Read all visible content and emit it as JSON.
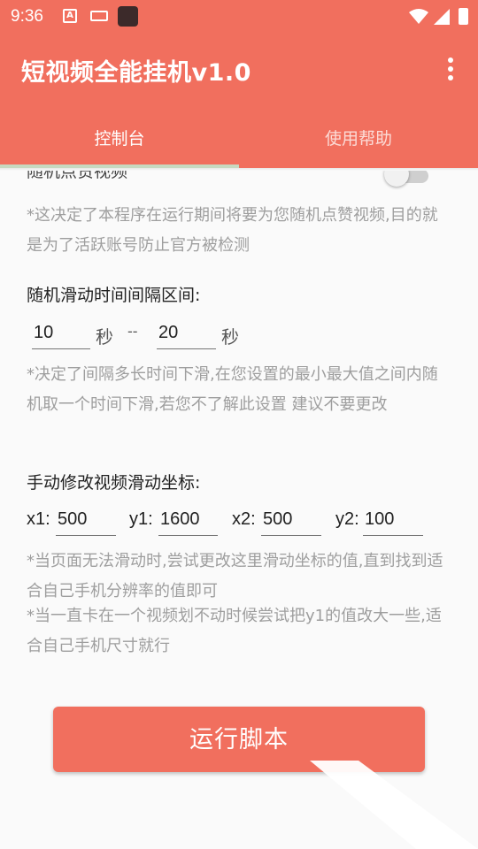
{
  "status_bar": {
    "time": "9:36",
    "a_icon": "A"
  },
  "app_bar": {
    "title": "短视频全能挂机v1.0"
  },
  "tabs": [
    {
      "label": "控制台"
    },
    {
      "label": "使用帮助"
    }
  ],
  "like_section": {
    "label": "随机点赞视频",
    "enabled": false,
    "note": "*这决定了本程序在运行期间将要为您随机点赞视频,目的就是为了活跃账号防止官方被检测"
  },
  "interval_section": {
    "label": "随机滑动时间间隔区间:",
    "min_value": "10",
    "max_value": "20",
    "unit": "秒",
    "separator": "--",
    "note": "*决定了间隔多长时间下滑,在您设置的最小最大值之间内随机取一个时间下滑,若您不了解此设置 建议不要更改"
  },
  "coords_section": {
    "label": "手动修改视频滑动坐标:",
    "x1_label": "x1:",
    "x1_value": "500",
    "y1_label": "y1:",
    "y1_value": "1600",
    "x2_label": "x2:",
    "x2_value": "500",
    "y2_label": "y2:",
    "y2_value": "100",
    "note1": "*当页面无法滑动时,尝试更改这里滑动坐标的值,直到找到适合自己手机分辨率的值即可",
    "note2": "*当一直卡在一个视频划不动时候尝试把y1的值改大一些,适合自己手机尺寸就行"
  },
  "run_button": {
    "label": "运行脚本"
  },
  "colors": {
    "primary": "#f16f5e",
    "indicator": "#c7d9c0",
    "note_text": "#9e9e9e"
  }
}
